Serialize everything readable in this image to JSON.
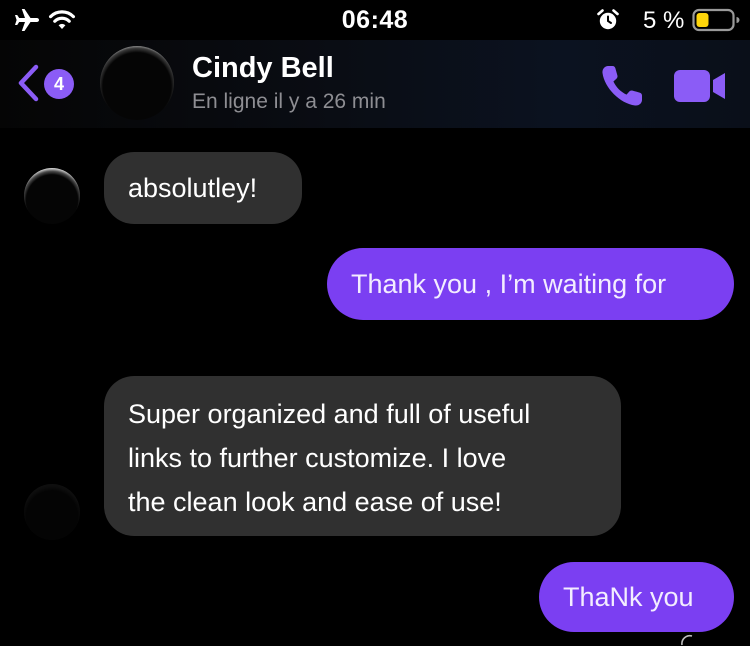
{
  "status_bar": {
    "time": "06:48",
    "battery_percent": "5 %",
    "battery_level": 0.05,
    "icons": [
      "airplane-icon",
      "wifi-icon",
      "alarm-icon",
      "battery-icon"
    ]
  },
  "header": {
    "unread_count": "4",
    "contact_name": "Cindy Bell",
    "presence": "En ligne il y a 26 min",
    "icons": [
      "chevron-left-icon",
      "phone-icon",
      "video-camera-icon"
    ]
  },
  "messages": [
    {
      "direction": "incoming",
      "text": "absolutley!"
    },
    {
      "direction": "outgoing",
      "text": "Thank you , I’m waiting for"
    },
    {
      "direction": "incoming",
      "lines": [
        "Super organized and full of useful",
        "links to further customize.  I love",
        "the clean look and ease of use!"
      ]
    },
    {
      "direction": "outgoing",
      "text": "ThaNk you"
    }
  ],
  "colors": {
    "accent": "#8b5cf6",
    "outgoing_bubble": "#7b3ff2",
    "incoming_bubble": "#303030",
    "background": "#000000",
    "secondary_text": "#8e8e93",
    "battery_low": "#ffd60a"
  }
}
